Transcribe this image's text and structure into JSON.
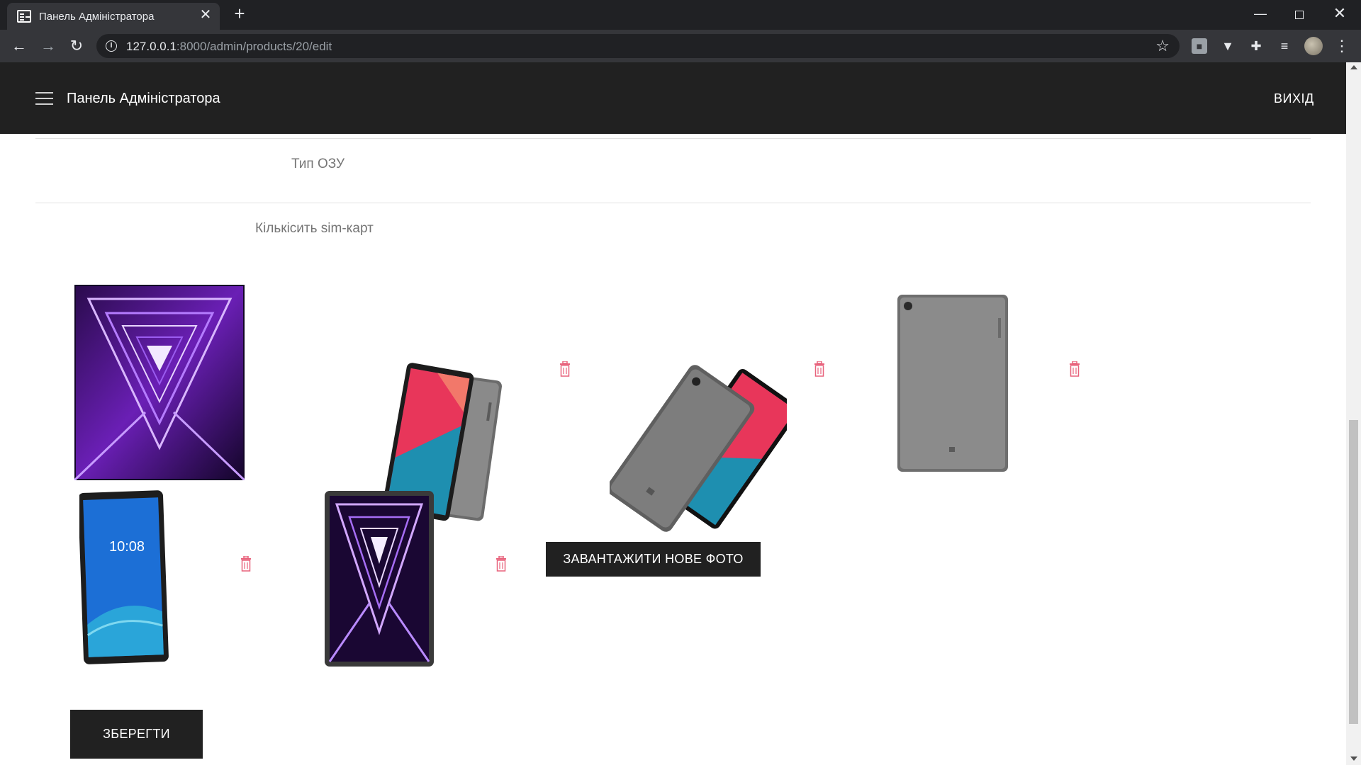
{
  "browser": {
    "tab_title": "Панель Адміністратора",
    "tab_close_glyph": "✕",
    "new_tab_glyph": "+",
    "url_host": "127.0.0.1",
    "url_path": ":8000/admin/products/20/edit"
  },
  "header": {
    "title": "Панель Адміністратора",
    "logout_label": "ВИХІД"
  },
  "form": {
    "field_ram_type_label": "Тип ОЗУ",
    "field_sim_count_label": "Кількісить sim-карт"
  },
  "gallery": {
    "main_photo": {
      "subject": "purple neon corridor wallpaper"
    },
    "photos": [
      {
        "subject": "tablet front and back angled"
      },
      {
        "subject": "tablet back angled with front screen"
      },
      {
        "subject": "tablet back grey"
      },
      {
        "subject": "tablet front lock screen",
        "screen_time": "10:08"
      },
      {
        "subject": "tablet front purple wallpaper"
      }
    ]
  },
  "actions": {
    "upload_label": "ЗАВАНТАЖИТИ НОВЕ ФОТО",
    "save_label": "ЗБЕРЕГТИ"
  },
  "colors": {
    "header_bg": "#212121",
    "trash_icon": "#e8627c",
    "button_bg": "#212121"
  }
}
